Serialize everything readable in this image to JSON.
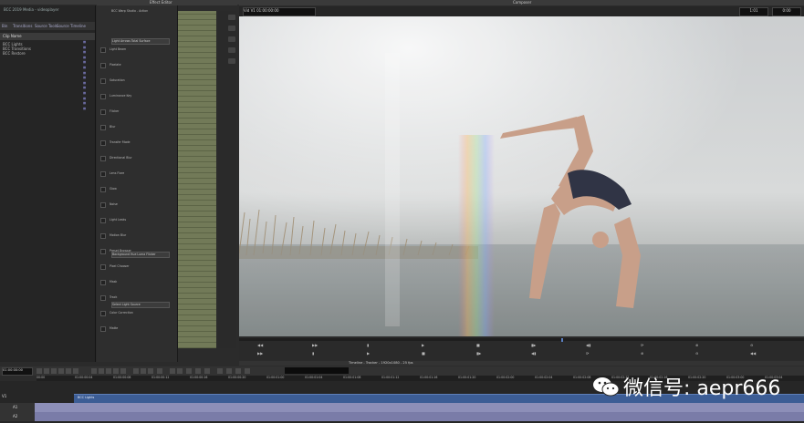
{
  "top": {
    "bin_window_title": "BCC 2019 Media - videoplayer",
    "effect_editor_title": "Effect Editor",
    "composer_title": "Composer",
    "fx_effect_name": "BCC Warp Studio - Action"
  },
  "bin": {
    "tabs": [
      "Bin",
      "Transitions",
      "Source Tools",
      "Source Timeline"
    ],
    "column_header": "Clip Name",
    "items": [
      "BCC Lights",
      "BCC Transitions",
      "BCC Restore"
    ]
  },
  "effect_editor": {
    "rows": [
      "Light Beam",
      "Pixelate",
      "Saturation",
      "Luminance Key",
      "Flicker",
      "Blur",
      "Transfer Mode",
      "Directional Blur",
      "Lens Flare",
      "Glow",
      "Noise",
      "Light Leaks",
      "Motion Blur",
      "Preset Browser",
      "Pixel Chooser",
      "Mask",
      "Track",
      "Color Correction",
      "Matte"
    ],
    "dropdown_1": "Light Arrows Total Surface",
    "dropdown_2": "Background Hue Luma Flicker",
    "dropdown_3": "Select Light Source"
  },
  "composer": {
    "left_timecode": "Vid  V1  01:00:00:00",
    "right_tc_1": "1:01",
    "right_tc_2": "0:00",
    "scrub_position": 0.57
  },
  "timeline": {
    "title": "Timeline - Tracker - 1920x1080 - 25 fps",
    "master_tc": "01:00:00:00",
    "ruler_labels": [
      "00:00",
      "01:00:00:04",
      "01:00:00:08",
      "01:00:00:12",
      "01:00:00:16",
      "01:00:00:20",
      "01:00:01:00",
      "01:00:01:04",
      "01:00:01:08",
      "01:00:01:12",
      "01:00:01:16",
      "01:00:01:20",
      "01:00:02:00",
      "01:00:02:04",
      "01:00:02:08",
      "01:00:02:12",
      "01:00:02:16",
      "01:00:02:20",
      "01:00:03:00",
      "01:00:03:04"
    ],
    "track_labels": [
      "V1",
      "A1",
      "A2"
    ],
    "clip_name": "BCC Lights"
  },
  "watermark": {
    "text": "微信号: aepr666"
  },
  "colors": {
    "clip": "#3c5d95",
    "audio": "#8d8fb8",
    "keyframe_bg": "#6b7252"
  }
}
